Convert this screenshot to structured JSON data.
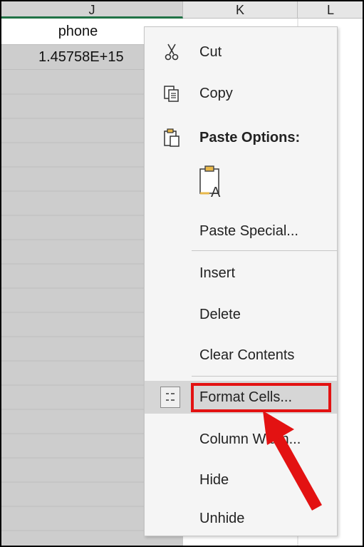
{
  "columns": {
    "j": "J",
    "k": "K",
    "l": "L"
  },
  "sheet": {
    "header_value": "phone",
    "first_value": "1.45758E+15"
  },
  "menu": {
    "cut": "Cut",
    "copy": "Copy",
    "paste_options": "Paste Options:",
    "paste_special": "Paste Special...",
    "insert": "Insert",
    "delete": "Delete",
    "clear_contents": "Clear Contents",
    "format_cells": "Format Cells...",
    "column_width": "Column Width...",
    "hide": "Hide",
    "unhide": "Unhide"
  },
  "colors": {
    "highlight": "#d6d6d6",
    "annotation": "#e31212",
    "selected_column": "#cdcdcd",
    "header_accent": "#217346"
  },
  "icons": {
    "cut": "scissors-icon",
    "copy": "copy-icon",
    "paste_options": "paste-icon",
    "paste_text_only": "clipboard-text-icon",
    "format_cells": "format-cells-icon"
  }
}
